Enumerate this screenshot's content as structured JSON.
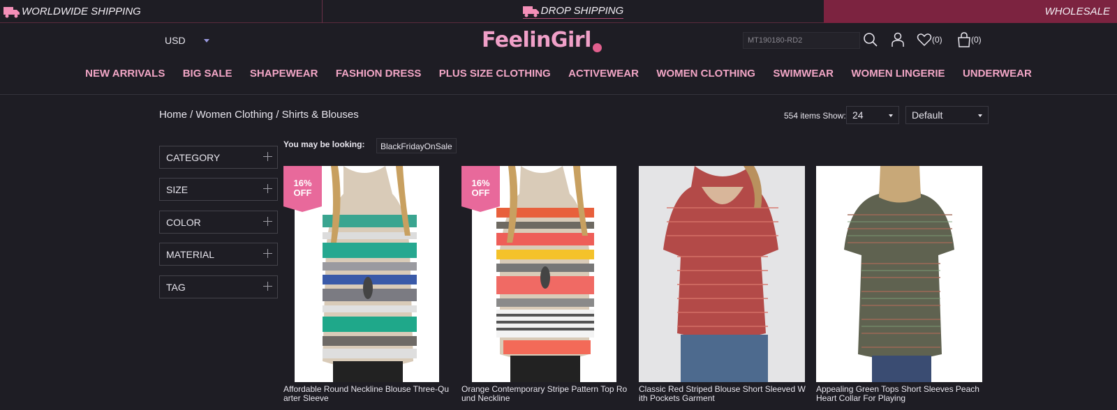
{
  "topbar": {
    "worldwide": "WORLDWIDE SHIPPING",
    "drop": "DROP SHIPPING",
    "wholesale": "WHOLESALE"
  },
  "header": {
    "currency": "USD",
    "logo": "FeelinGirl",
    "search_value": "MT190180-RD2",
    "wishlist_count": "(0)",
    "cart_count": "(0)"
  },
  "nav": [
    "NEW ARRIVALS",
    "BIG SALE",
    "SHAPEWEAR",
    "FASHION DRESS",
    "PLUS SIZE CLOTHING",
    "ACTIVEWEAR",
    "WOMEN CLOTHING",
    "SWIMWEAR",
    "WOMEN LINGERIE",
    "UNDERWEAR"
  ],
  "breadcrumb": [
    "Home",
    "Women Clothing",
    "Shirts & Blouses"
  ],
  "toolbar": {
    "items": "554 items",
    "show_label": "Show:",
    "show_value": "24",
    "sort_value": "Default"
  },
  "filters": [
    "CATEGORY",
    "SIZE",
    "COLOR",
    "MATERIAL",
    "TAG"
  ],
  "looking": {
    "label": "You may be looking:",
    "tag": "BlackFridayOnSale"
  },
  "products": [
    {
      "title_line1": "Affordable Round Neckline Blouse Three-Qu",
      "title_line2": "arter Sleeve",
      "badge_pct": "16%",
      "badge_off": "OFF"
    },
    {
      "title_line1": "Orange Contemporary Stripe Pattern Top Ro",
      "title_line2": "und Neckline",
      "badge_pct": "16%",
      "badge_off": "OFF"
    },
    {
      "title_line1": "Classic Red Striped Blouse Short Sleeved W",
      "title_line2": "ith Pockets Garment"
    },
    {
      "title_line1": "Appealing Green Tops Short Sleeves Peach",
      "title_line2": "Heart Collar For Playing"
    }
  ],
  "colors": {
    "accent_pink": "#f2a6c6",
    "wholesale_bg": "#7c2340",
    "badge_pink": "#e8699b",
    "background": "#1e1d24"
  }
}
